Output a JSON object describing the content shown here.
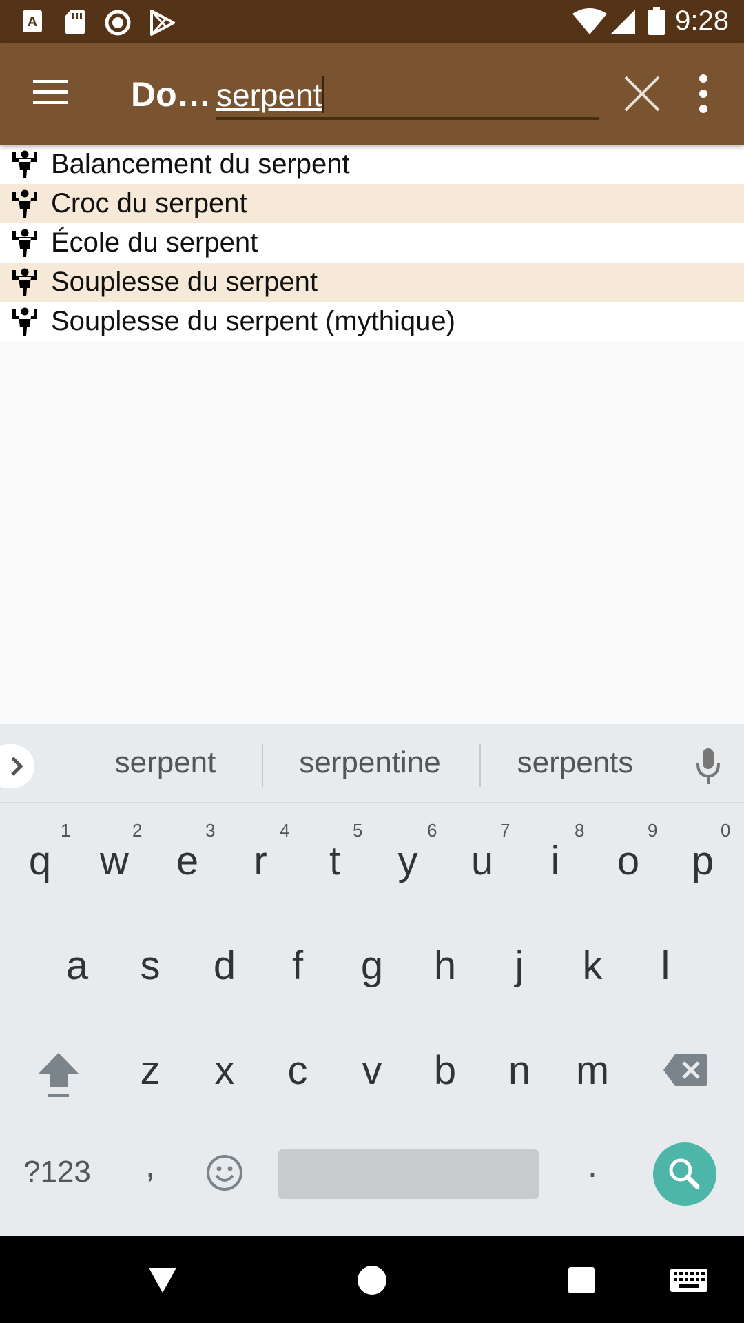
{
  "status_bar": {
    "time": "9:28",
    "left_icons": [
      "app-a-icon",
      "sd-card-icon",
      "circle-record-icon",
      "play-store-icon"
    ],
    "right_icons": [
      "wifi-icon",
      "signal-icon",
      "battery-icon"
    ]
  },
  "app_bar": {
    "title": "Do…",
    "search_value": "serpent",
    "bg_color": "#7a5431"
  },
  "results": [
    {
      "label": "Balancement du serpent",
      "icon": "strength-figure-icon"
    },
    {
      "label": "Croc du serpent",
      "icon": "strength-figure-icon"
    },
    {
      "label": "École du serpent",
      "icon": "strength-figure-icon"
    },
    {
      "label": "Souplesse du serpent",
      "icon": "strength-figure-icon"
    },
    {
      "label": "Souplesse du serpent (mythique)",
      "icon": "strength-figure-icon"
    }
  ],
  "keyboard": {
    "suggestions": [
      "serpent",
      "serpentine",
      "serpents"
    ],
    "row1": [
      "q",
      "w",
      "e",
      "r",
      "t",
      "y",
      "u",
      "i",
      "o",
      "p"
    ],
    "row1_hints": [
      "1",
      "2",
      "3",
      "4",
      "5",
      "6",
      "7",
      "8",
      "9",
      "0"
    ],
    "row2": [
      "a",
      "s",
      "d",
      "f",
      "g",
      "h",
      "j",
      "k",
      "l"
    ],
    "row3": [
      "z",
      "x",
      "c",
      "v",
      "b",
      "n",
      "m"
    ],
    "symbols_label": "?123",
    "comma": ",",
    "period": "."
  }
}
